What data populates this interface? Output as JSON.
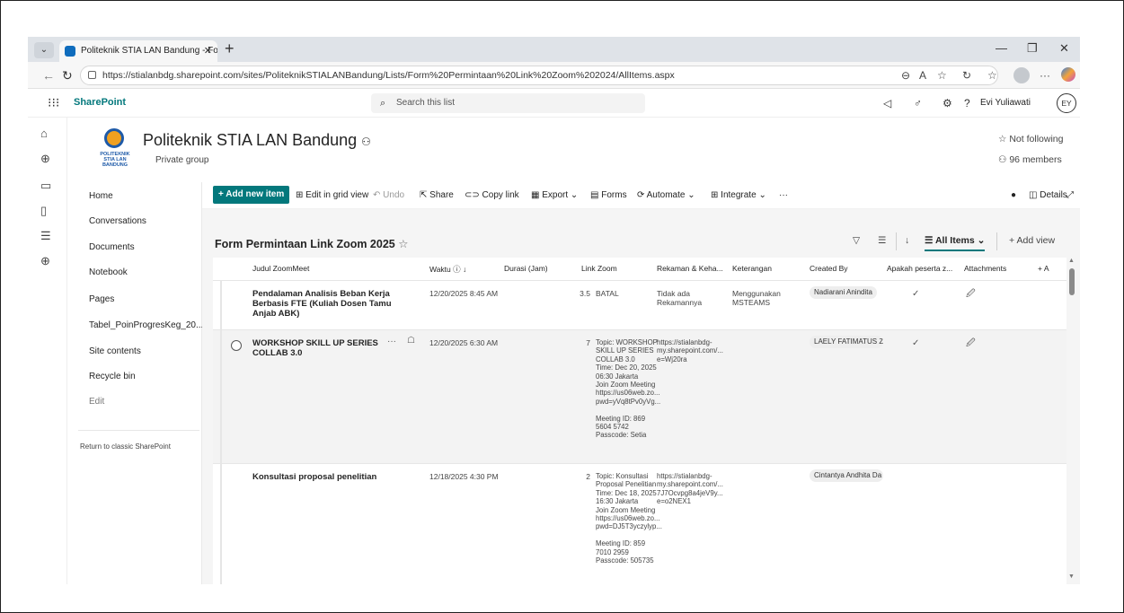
{
  "browser": {
    "tab_title": "Politeknik STIA LAN Bandung - Fo",
    "url": "https://stialanbdg.sharepoint.com/sites/PoliteknikSTIALANBandung/Lists/Form%20Permintaan%20Link%20Zoom%202024/AllItems.aspx"
  },
  "suite": {
    "brand": "SharePoint",
    "search_placeholder": "Search this list",
    "user_name": "Evi Yuliawati",
    "user_initials": "EY"
  },
  "site": {
    "logo_text": "POLITEKNIK STIA LAN BANDUNG",
    "title": "Politeknik STIA LAN Bandung",
    "subtitle": "Private group",
    "follow_label": "Not following",
    "members_label": "96 members"
  },
  "nav": {
    "items": [
      "Home",
      "Conversations",
      "Documents",
      "Notebook",
      "Pages",
      "Tabel_PoinProgresKeg_20...",
      "Site contents",
      "Recycle bin"
    ],
    "edit": "Edit",
    "classic": "Return to classic SharePoint"
  },
  "commands": {
    "add_new": "Add new item",
    "edit_grid": "Edit in grid view",
    "undo": "Undo",
    "share": "Share",
    "copy_link": "Copy link",
    "export": "Export",
    "forms": "Forms",
    "automate": "Automate",
    "integrate": "Integrate",
    "more": "···",
    "details": "Details"
  },
  "list": {
    "title": "Form Permintaan Link Zoom 2025",
    "view_name": "All Items",
    "add_view": "Add view",
    "columns": [
      "Judul ZoomMeet",
      "Waktu",
      "Durasi (Jam)",
      "Link Zoom",
      "Rekaman & Keha...",
      "Keterangan",
      "Created By",
      "Apakah peserta z...",
      "Attachments",
      "+ A"
    ],
    "rows": [
      {
        "title": "Pendalaman Analisis Beban Kerja Berbasis FTE (Kuliah Dosen Tamu Anjab ABK)",
        "waktu": "12/20/2025 8:45 AM",
        "durasi": "3.5",
        "link": "BATAL",
        "rekaman": "Tidak ada Rekamannya",
        "keterangan": "Menggunakan MSTEAMS",
        "created_by": "Nadiarani Anindita",
        "check": "✓",
        "attach": "🖉"
      },
      {
        "title": "WORKSHOP SKILL UP SERIES COLLAB 3.0",
        "waktu": "12/20/2025 6:30 AM",
        "durasi": "7",
        "link": "Topic: WORKSHOP\nSKILL UP SERIES\nCOLLAB 3.0\nTime: Dec 20, 2025\n06:30 Jakarta\nJoin Zoom Meeting\nhttps://us06web.zo...\npwd=yVq8tPv0yVg...\n\nMeeting ID: 869\n5604 5742\nPasscode: Setia",
        "rekaman": "https://stialanbdg-\nmy.sharepoint.com/...\ne=Wj20ra",
        "keterangan": "",
        "created_by": "LAELY FATIMATUS ZAI",
        "check": "✓",
        "attach": "🖉",
        "more": "···"
      },
      {
        "title": "Konsultasi proposal penelitian",
        "waktu": "12/18/2025 4:30 PM",
        "durasi": "2",
        "link": "Topic: Konsultasi\nProposal Penelitian\nTime: Dec 18, 2025\n16:30 Jakarta\nJoin Zoom Meeting\nhttps://us06web.zo...\npwd=DJ5T3yczylyp...\n\nMeeting ID: 859\n7010 2959\nPasscode: 505735",
        "rekaman": "https://stialanbdg-\nmy.sharepoint.com/...\n7J7Ocvpg8a4jeV9y...\ne=o2NEX1",
        "keterangan": "",
        "created_by": "Cintantya Andhita Da",
        "check": "",
        "attach": ""
      }
    ]
  },
  "colors": {
    "accent": "#03787c",
    "list_bg": "#f5f5f5"
  }
}
